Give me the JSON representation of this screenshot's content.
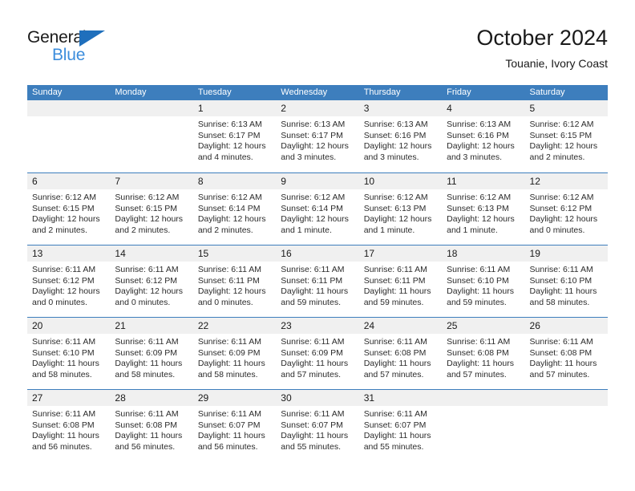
{
  "brand": {
    "line1": "General",
    "line2": "Blue",
    "triangle_icon": "triangle-icon",
    "color_dark": "#1a1a1a",
    "color_blue": "#3c8ddc",
    "triangle_color": "#1f6fbc"
  },
  "header": {
    "title": "October 2024",
    "subtitle": "Touanie, Ivory Coast"
  },
  "theme": {
    "header_bg": "#3d7ebd",
    "header_text": "#ffffff",
    "day_head_bg": "#f0f0f0",
    "cell_bg": "#ffffff",
    "row_divider": "#3d7ebd"
  },
  "weekdays": [
    "Sunday",
    "Monday",
    "Tuesday",
    "Wednesday",
    "Thursday",
    "Friday",
    "Saturday"
  ],
  "weeks": [
    [
      {
        "day": "",
        "lines": []
      },
      {
        "day": "",
        "lines": []
      },
      {
        "day": "1",
        "lines": [
          "Sunrise: 6:13 AM",
          "Sunset: 6:17 PM",
          "Daylight: 12 hours",
          "and 4 minutes."
        ]
      },
      {
        "day": "2",
        "lines": [
          "Sunrise: 6:13 AM",
          "Sunset: 6:17 PM",
          "Daylight: 12 hours",
          "and 3 minutes."
        ]
      },
      {
        "day": "3",
        "lines": [
          "Sunrise: 6:13 AM",
          "Sunset: 6:16 PM",
          "Daylight: 12 hours",
          "and 3 minutes."
        ]
      },
      {
        "day": "4",
        "lines": [
          "Sunrise: 6:13 AM",
          "Sunset: 6:16 PM",
          "Daylight: 12 hours",
          "and 3 minutes."
        ]
      },
      {
        "day": "5",
        "lines": [
          "Sunrise: 6:12 AM",
          "Sunset: 6:15 PM",
          "Daylight: 12 hours",
          "and 2 minutes."
        ]
      }
    ],
    [
      {
        "day": "6",
        "lines": [
          "Sunrise: 6:12 AM",
          "Sunset: 6:15 PM",
          "Daylight: 12 hours",
          "and 2 minutes."
        ]
      },
      {
        "day": "7",
        "lines": [
          "Sunrise: 6:12 AM",
          "Sunset: 6:15 PM",
          "Daylight: 12 hours",
          "and 2 minutes."
        ]
      },
      {
        "day": "8",
        "lines": [
          "Sunrise: 6:12 AM",
          "Sunset: 6:14 PM",
          "Daylight: 12 hours",
          "and 2 minutes."
        ]
      },
      {
        "day": "9",
        "lines": [
          "Sunrise: 6:12 AM",
          "Sunset: 6:14 PM",
          "Daylight: 12 hours",
          "and 1 minute."
        ]
      },
      {
        "day": "10",
        "lines": [
          "Sunrise: 6:12 AM",
          "Sunset: 6:13 PM",
          "Daylight: 12 hours",
          "and 1 minute."
        ]
      },
      {
        "day": "11",
        "lines": [
          "Sunrise: 6:12 AM",
          "Sunset: 6:13 PM",
          "Daylight: 12 hours",
          "and 1 minute."
        ]
      },
      {
        "day": "12",
        "lines": [
          "Sunrise: 6:12 AM",
          "Sunset: 6:12 PM",
          "Daylight: 12 hours",
          "and 0 minutes."
        ]
      }
    ],
    [
      {
        "day": "13",
        "lines": [
          "Sunrise: 6:11 AM",
          "Sunset: 6:12 PM",
          "Daylight: 12 hours",
          "and 0 minutes."
        ]
      },
      {
        "day": "14",
        "lines": [
          "Sunrise: 6:11 AM",
          "Sunset: 6:12 PM",
          "Daylight: 12 hours",
          "and 0 minutes."
        ]
      },
      {
        "day": "15",
        "lines": [
          "Sunrise: 6:11 AM",
          "Sunset: 6:11 PM",
          "Daylight: 12 hours",
          "and 0 minutes."
        ]
      },
      {
        "day": "16",
        "lines": [
          "Sunrise: 6:11 AM",
          "Sunset: 6:11 PM",
          "Daylight: 11 hours",
          "and 59 minutes."
        ]
      },
      {
        "day": "17",
        "lines": [
          "Sunrise: 6:11 AM",
          "Sunset: 6:11 PM",
          "Daylight: 11 hours",
          "and 59 minutes."
        ]
      },
      {
        "day": "18",
        "lines": [
          "Sunrise: 6:11 AM",
          "Sunset: 6:10 PM",
          "Daylight: 11 hours",
          "and 59 minutes."
        ]
      },
      {
        "day": "19",
        "lines": [
          "Sunrise: 6:11 AM",
          "Sunset: 6:10 PM",
          "Daylight: 11 hours",
          "and 58 minutes."
        ]
      }
    ],
    [
      {
        "day": "20",
        "lines": [
          "Sunrise: 6:11 AM",
          "Sunset: 6:10 PM",
          "Daylight: 11 hours",
          "and 58 minutes."
        ]
      },
      {
        "day": "21",
        "lines": [
          "Sunrise: 6:11 AM",
          "Sunset: 6:09 PM",
          "Daylight: 11 hours",
          "and 58 minutes."
        ]
      },
      {
        "day": "22",
        "lines": [
          "Sunrise: 6:11 AM",
          "Sunset: 6:09 PM",
          "Daylight: 11 hours",
          "and 58 minutes."
        ]
      },
      {
        "day": "23",
        "lines": [
          "Sunrise: 6:11 AM",
          "Sunset: 6:09 PM",
          "Daylight: 11 hours",
          "and 57 minutes."
        ]
      },
      {
        "day": "24",
        "lines": [
          "Sunrise: 6:11 AM",
          "Sunset: 6:08 PM",
          "Daylight: 11 hours",
          "and 57 minutes."
        ]
      },
      {
        "day": "25",
        "lines": [
          "Sunrise: 6:11 AM",
          "Sunset: 6:08 PM",
          "Daylight: 11 hours",
          "and 57 minutes."
        ]
      },
      {
        "day": "26",
        "lines": [
          "Sunrise: 6:11 AM",
          "Sunset: 6:08 PM",
          "Daylight: 11 hours",
          "and 57 minutes."
        ]
      }
    ],
    [
      {
        "day": "27",
        "lines": [
          "Sunrise: 6:11 AM",
          "Sunset: 6:08 PM",
          "Daylight: 11 hours",
          "and 56 minutes."
        ]
      },
      {
        "day": "28",
        "lines": [
          "Sunrise: 6:11 AM",
          "Sunset: 6:08 PM",
          "Daylight: 11 hours",
          "and 56 minutes."
        ]
      },
      {
        "day": "29",
        "lines": [
          "Sunrise: 6:11 AM",
          "Sunset: 6:07 PM",
          "Daylight: 11 hours",
          "and 56 minutes."
        ]
      },
      {
        "day": "30",
        "lines": [
          "Sunrise: 6:11 AM",
          "Sunset: 6:07 PM",
          "Daylight: 11 hours",
          "and 55 minutes."
        ]
      },
      {
        "day": "31",
        "lines": [
          "Sunrise: 6:11 AM",
          "Sunset: 6:07 PM",
          "Daylight: 11 hours",
          "and 55 minutes."
        ]
      },
      {
        "day": "",
        "lines": []
      },
      {
        "day": "",
        "lines": []
      }
    ]
  ]
}
